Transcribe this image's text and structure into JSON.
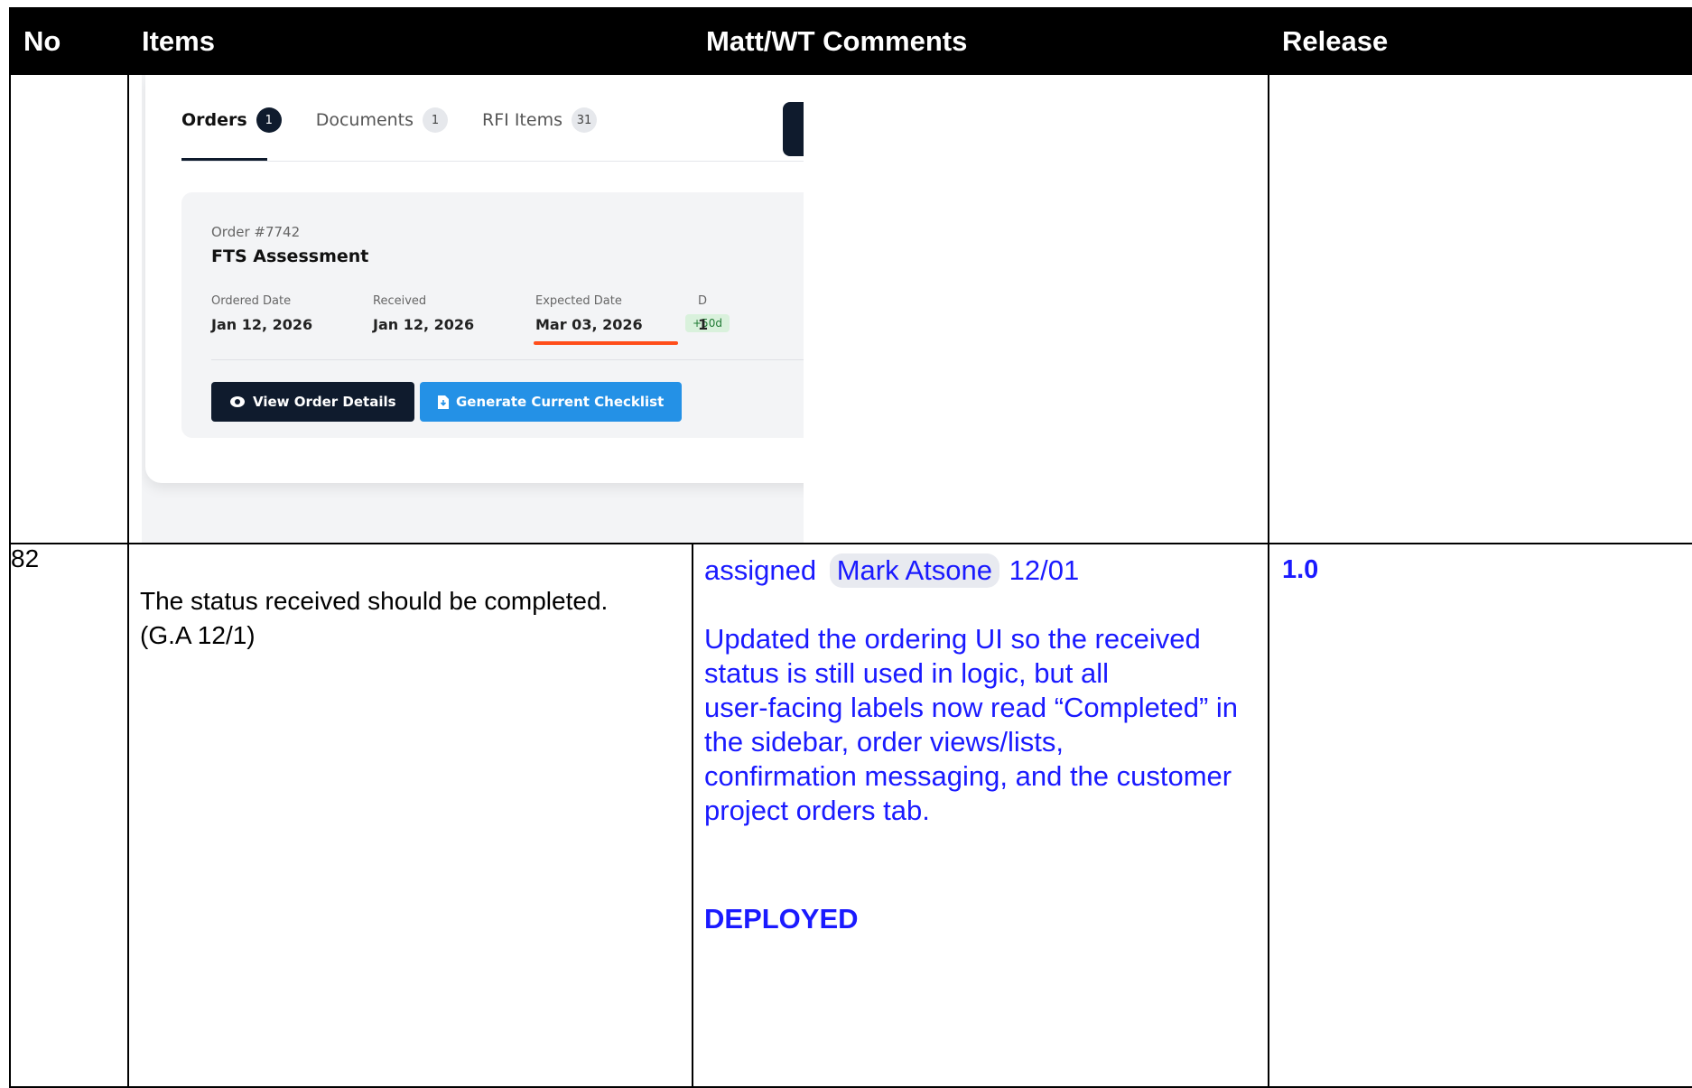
{
  "headers": {
    "no": "No",
    "items": "Items",
    "comments": "Matt/WT Comments",
    "release": "Release"
  },
  "screenshot": {
    "tabs": [
      {
        "label": "Orders",
        "count": "1"
      },
      {
        "label": "Documents",
        "count": "1"
      },
      {
        "label": "RFI Items",
        "count": "31"
      }
    ],
    "order_number": "Order #7742",
    "order_title": "FTS Assessment",
    "fields": [
      {
        "label": "Ordered Date",
        "value": "Jan 12, 2026"
      },
      {
        "label": "Received",
        "value": "Jan 12, 2026"
      },
      {
        "label": "Expected Date",
        "value": "Mar 03, 2026"
      },
      {
        "label": "D",
        "value": "1"
      }
    ],
    "expected_badge": "+50d",
    "view_button": "View Order Details",
    "checklist_button": "Generate Current Checklist"
  },
  "row82": {
    "no": "82",
    "item_text": "The status received should be completed. (G.A 12/1)",
    "assigned_prefix": "assigned",
    "assignee": "Mark Atsone",
    "assigned_date": "12/01",
    "comment_lines": [
      "Updated the ordering UI so the received status is still used in logic, but all",
      "user-facing labels now read “Completed” in the sidebar, order views/lists,",
      "confirmation messaging, and the customer project orders tab."
    ],
    "status": "DEPLOYED",
    "release": "1.0"
  }
}
